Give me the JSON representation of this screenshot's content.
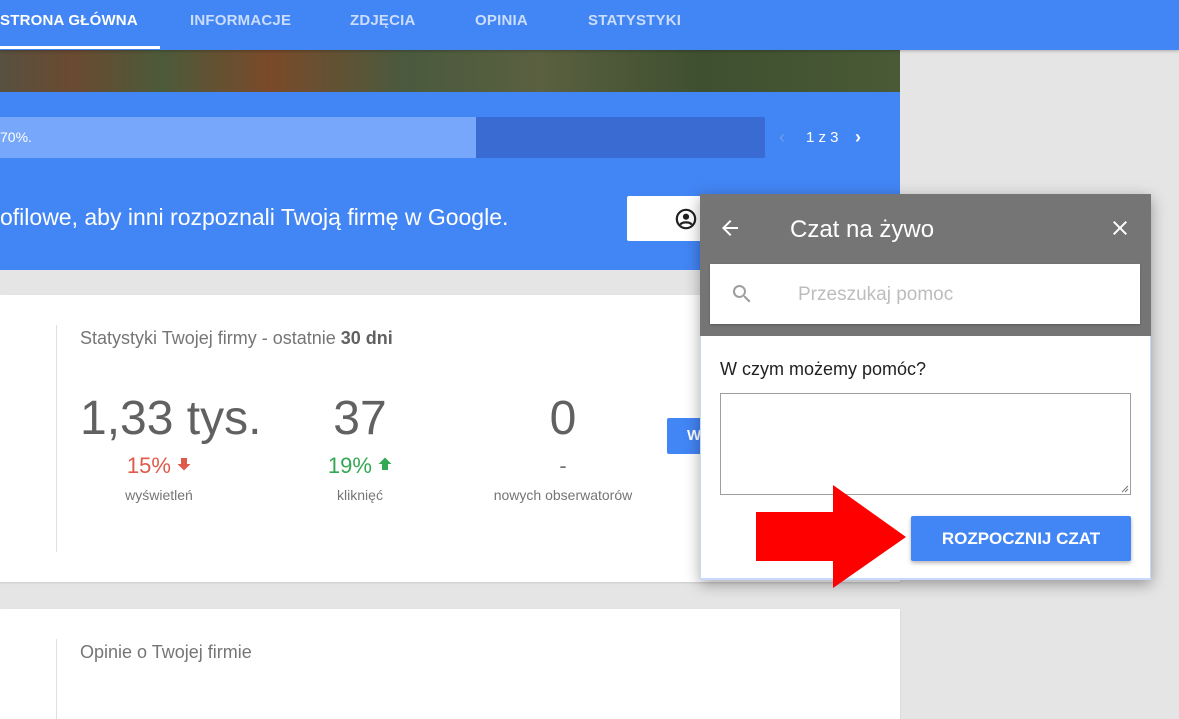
{
  "nav": {
    "tabs": [
      {
        "label": "STRONA GŁÓWNA",
        "active": true
      },
      {
        "label": "INFORMACJE"
      },
      {
        "label": "ZDJĘCIA"
      },
      {
        "label": "OPINIA"
      },
      {
        "label": "STATYSTYKI"
      }
    ]
  },
  "banner": {
    "progress_text": "70%.",
    "progress_percent": 70,
    "pager": {
      "text": "1 z 3"
    },
    "message": "ofilowe, aby inni rozpoznali Twoją firmę w Google.",
    "button_icon": "account-circle-icon"
  },
  "stats_card": {
    "title_prefix": "Statystyki Twojej firmy - ostatnie ",
    "title_bold": "30 dni",
    "stats": [
      {
        "value": "1,33 tys.",
        "change": "15%",
        "direction": "down",
        "label": "wyświetleń"
      },
      {
        "value": "37",
        "change": "19%",
        "direction": "up",
        "label": "kliknięć"
      },
      {
        "value": "0",
        "change": "-",
        "direction": "none",
        "label": "nowych obserwatorów"
      }
    ],
    "button_label": "W"
  },
  "reviews_card": {
    "title": "Opinie o Twojej firmie"
  },
  "chat": {
    "title": "Czat na żywo",
    "search_placeholder": "Przeszukaj pomoc",
    "question": "W czym możemy pomóc?",
    "message_value": "",
    "start_button": "ROZPOCZNIJ CZAT"
  },
  "colors": {
    "primary": "#4285f4",
    "header_grey": "#757575",
    "decrease": "#e05a4b",
    "increase": "#34a853",
    "annotation_arrow": "#ff0000"
  }
}
